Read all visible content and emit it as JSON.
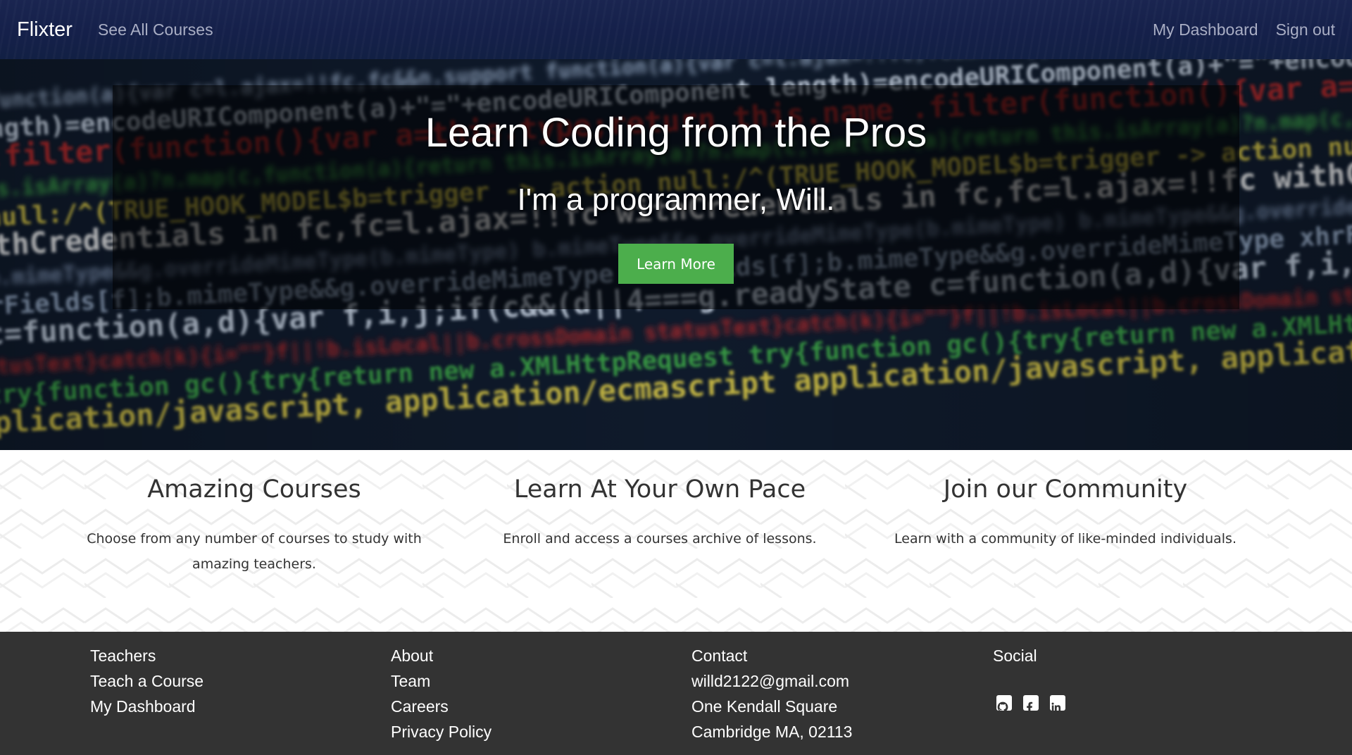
{
  "navbar": {
    "brand": "Flixter",
    "left_link": "See All Courses",
    "right_links": [
      "My Dashboard",
      "Sign out"
    ],
    "background_color": "#16214a"
  },
  "hero": {
    "title": "Learn Coding from the Pros",
    "subtitle": "I'm a programmer, Will.",
    "button_label": "Learn More",
    "button_color": "#4cae4c",
    "background_image_text": [
      "function(a){var c=l.ajax=!!fc,fc&&n.support",
      "length)=encodeURIComponent(a)+\"=\"+encodeURIComponent",
      ".filter(function(){var a=this.type;return this.name",
      "this.isArray(a)?n.map(c,function(a){return",
      "null:/^(TRUE_HOOK_MODEL$b=trigger -> action",
      "withCredentials in fc,fc=l.ajax=!!fc",
      "b.mimeType&&g.overrideMimeType(b.mimeType)",
      "xhrFields[f];b.mimeType&&g.overrideMimeType",
      "c=function(a,d){var f,i,j;if(c&&(d||4===g.readyState",
      "statusText}catch(k){i=\"\"}f||!b.isLocal||b.crossDomain",
      "try{function gc(){try{return new a.XMLHttpRequest",
      "application/javascript, application/ecmascript"
    ]
  },
  "features": [
    {
      "title": "Amazing Courses",
      "text": "Choose from any number of courses to study with amazing teachers."
    },
    {
      "title": "Learn At Your Own Pace",
      "text": "Enroll and access a courses archive of lessons."
    },
    {
      "title": "Join our Community",
      "text": "Learn with a community of like-minded individuals."
    }
  ],
  "footer": {
    "teachers": {
      "heading": "Teachers",
      "links": [
        "Teach a Course",
        "My Dashboard"
      ]
    },
    "about": {
      "heading": "About",
      "links": [
        "Team",
        "Careers",
        "Privacy Policy"
      ]
    },
    "contact": {
      "heading": "Contact",
      "email": "willd2122@gmail.com",
      "address_line1": "One Kendall Square",
      "address_line2": "Cambridge MA, 02113"
    },
    "social": {
      "heading": "Social",
      "icons": [
        "github-icon",
        "facebook-icon",
        "linkedin-icon"
      ]
    },
    "background_color": "#333333"
  }
}
